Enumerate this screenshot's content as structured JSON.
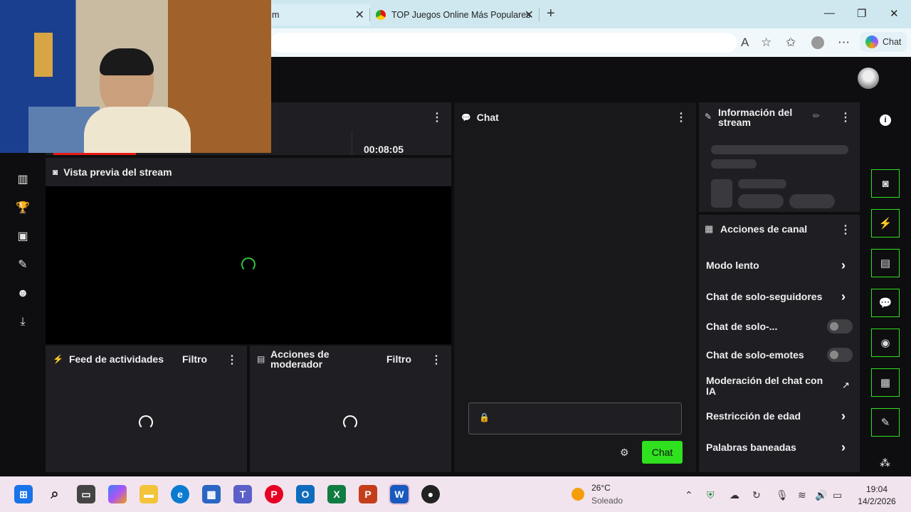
{
  "browser": {
    "tab1_partial": "m",
    "tab2_title": "TOP Juegos Online Más Populares",
    "chat_button": "Chat"
  },
  "stream": {
    "timer": "00:08:05",
    "preview_title": "Vista previa del stream",
    "activity_feed_title": "Feed de actividades",
    "filter_label": "Filtro",
    "mod_actions_title": "Acciones de moderador",
    "chat_title": "Chat",
    "chat_send": "Chat",
    "info_title": "Información del stream",
    "channel_actions_title": "Acciones de canal",
    "channel_actions": [
      {
        "label": "Modo lento",
        "control": "chevron"
      },
      {
        "label": "Chat de solo-seguidores",
        "control": "chevron"
      },
      {
        "label": "Chat de solo-...",
        "control": "toggle",
        "on": false
      },
      {
        "label": "Chat de solo-emotes",
        "control": "toggle",
        "on": false
      },
      {
        "label": "Moderación del chat con IA",
        "control": "external-link"
      },
      {
        "label": "Restricción de edad",
        "control": "chevron"
      },
      {
        "label": "Palabras baneadas",
        "control": "chevron"
      }
    ]
  },
  "taskbar": {
    "temperature": "26°C",
    "weather": "Soleado",
    "time": "19:04",
    "date": "14/2/2026"
  },
  "colors": {
    "accent": "#2fe11e",
    "live": "#e91916",
    "panel": "#1f1f23"
  }
}
